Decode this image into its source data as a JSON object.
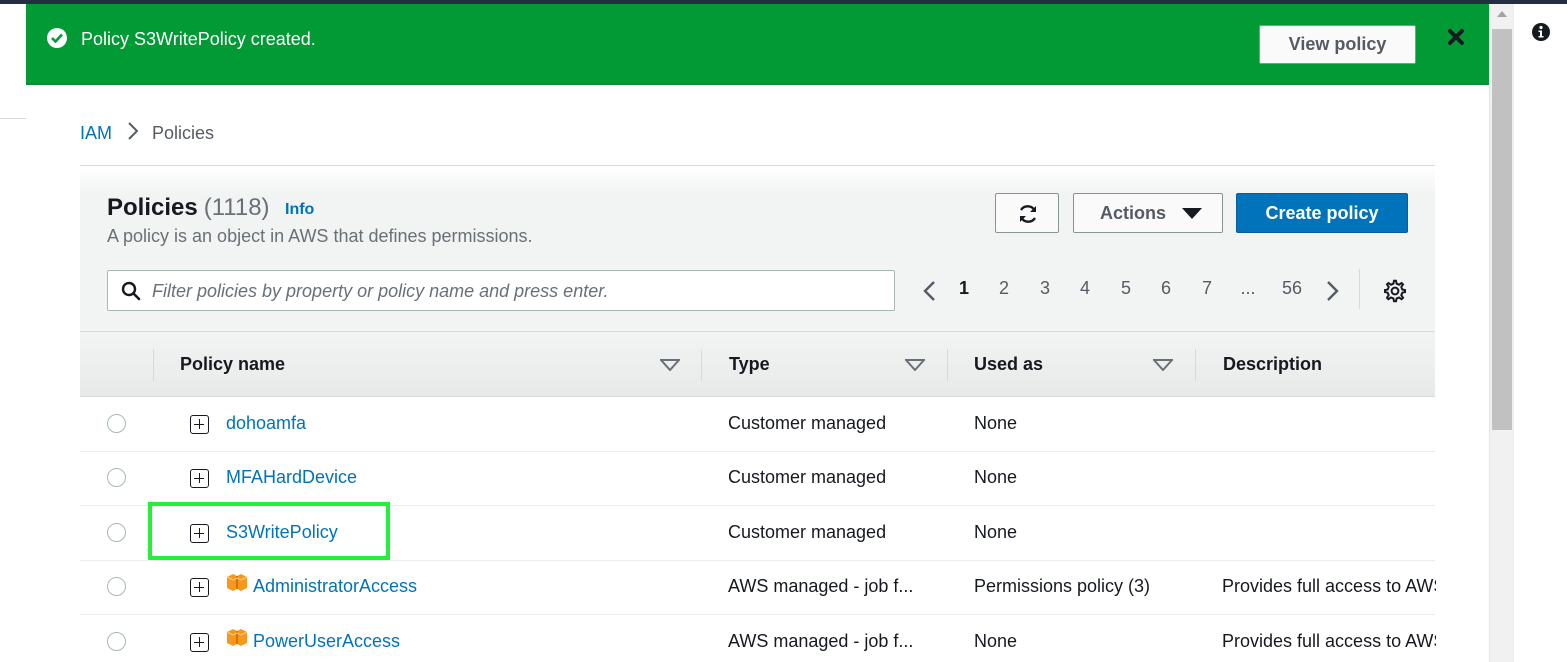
{
  "flash": {
    "message": "Policy S3WritePolicy created.",
    "view_button": "View policy",
    "color": "#029a34"
  },
  "breadcrumb": {
    "root": "IAM",
    "current": "Policies"
  },
  "header": {
    "title": "Policies",
    "count": "(1118)",
    "info": "Info",
    "description": "A policy is an object in AWS that defines permissions.",
    "actions_label": "Actions",
    "create_label": "Create policy"
  },
  "search": {
    "placeholder": "Filter policies by property or policy name and press enter."
  },
  "pagination": {
    "pages": [
      "1",
      "2",
      "3",
      "4",
      "5",
      "6",
      "7",
      "...",
      "56"
    ],
    "current": "1"
  },
  "table": {
    "columns": [
      "Policy name",
      "Type",
      "Used as",
      "Description"
    ],
    "rows": [
      {
        "name": "dohoamfa",
        "type": "Customer managed",
        "used_as": "None",
        "description": "",
        "aws_managed": false
      },
      {
        "name": "MFAHardDevice",
        "type": "Customer managed",
        "used_as": "None",
        "description": "",
        "aws_managed": false
      },
      {
        "name": "S3WritePolicy",
        "type": "Customer managed",
        "used_as": "None",
        "description": "",
        "aws_managed": false,
        "highlighted": true
      },
      {
        "name": "AdministratorAccess",
        "type": "AWS managed - job f...",
        "used_as": "Permissions policy (3)",
        "description": "Provides full access to AWS",
        "aws_managed": true
      },
      {
        "name": "PowerUserAccess",
        "type": "AWS managed - job f...",
        "used_as": "None",
        "description": "Provides full access to AWS",
        "aws_managed": true
      }
    ]
  },
  "colors": {
    "link": "#0073bb",
    "primary_button": "#0073bb",
    "highlight_box": "#25ef3a",
    "aws_icon": "#f7981d"
  }
}
